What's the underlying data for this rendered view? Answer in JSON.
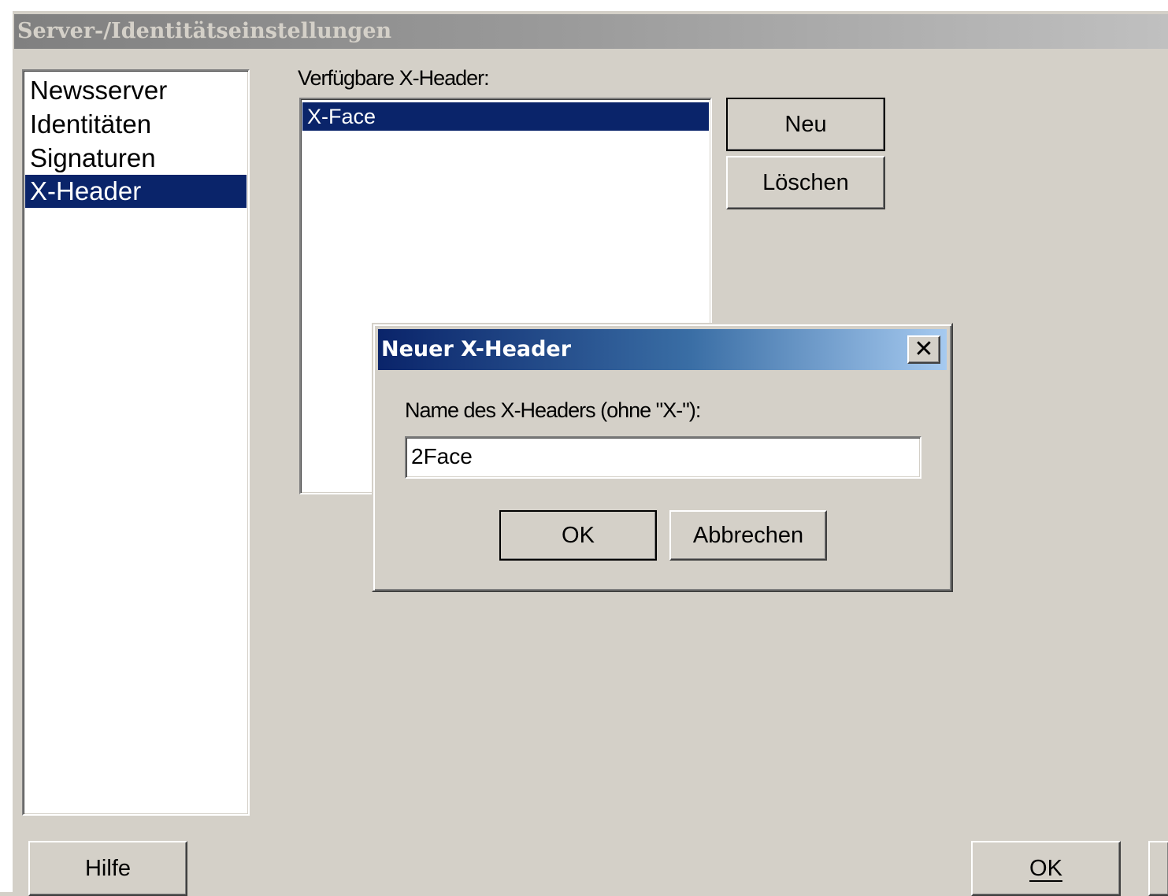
{
  "window": {
    "title": "Server-/Identitätseinstellungen"
  },
  "nav": {
    "items": [
      {
        "label": "Newsserver",
        "selected": false
      },
      {
        "label": "Identitäten",
        "selected": false
      },
      {
        "label": "Signaturen",
        "selected": false
      },
      {
        "label": "X-Header",
        "selected": true
      }
    ]
  },
  "xheader_panel": {
    "list_label": "Verfügbare X-Header:",
    "items": [
      {
        "label": "X-Face",
        "selected": true
      }
    ],
    "new_button": "Neu",
    "delete_button": "Löschen"
  },
  "dialog": {
    "title": "Neuer X-Header",
    "close_glyph": "✕",
    "field_label": "Name des X-Headers (ohne \"X-\"):",
    "field_value": "2Face",
    "ok_button": "OK",
    "cancel_button": "Abbrechen"
  },
  "footer": {
    "help_button": "Hilfe",
    "ok_button": "OK"
  },
  "colors": {
    "face": "#d4d0c8",
    "selection": "#0a246a",
    "active_title_start": "#0a246a",
    "active_title_end": "#a6caf0",
    "inactive_title": "#808080"
  }
}
